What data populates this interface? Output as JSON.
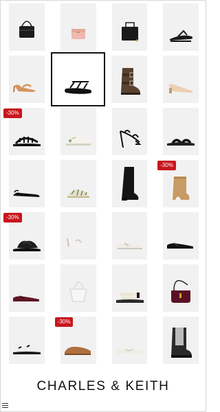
{
  "brand": {
    "name": "CHARLES & KEITH"
  },
  "menu": {
    "icon": "hamburger-menu-icon"
  },
  "accent": {
    "badge": "#c8161d",
    "tile_bg": "#f1f1f1"
  },
  "products": [
    {
      "icon": "black-tote-bag-icon"
    },
    {
      "icon": "pink-wallet-icon"
    },
    {
      "icon": "black-handbag-icon"
    },
    {
      "icon": "black-flip-flop-sandal-icon"
    },
    {
      "icon": "tan-slingback-heel-icon"
    },
    {
      "icon": "black-strappy-platform-sandal-icon"
    },
    {
      "icon": "brown-buckle-boot-icon"
    },
    {
      "icon": "beige-pointed-pump-icon"
    },
    {
      "icon": "black-woven-sandal-icon",
      "badge": "-30%"
    },
    {
      "icon": "white-sneaker-icon"
    },
    {
      "icon": "black-strappy-heel-icon"
    },
    {
      "icon": "black-slide-sandal-icon"
    },
    {
      "icon": "black-slingback-flat-icon"
    },
    {
      "icon": "mesh-fisherman-flat-icon"
    },
    {
      "icon": "black-knee-boot-icon"
    },
    {
      "icon": "tan-ankle-boot-icon",
      "badge": "-30%"
    },
    {
      "icon": "black-knot-mule-icon",
      "badge": "-30%"
    },
    {
      "icon": "white-slingback-heel-icon"
    },
    {
      "icon": "white-mary-jane-flat-icon"
    },
    {
      "icon": "black-mary-jane-flat-icon"
    },
    {
      "icon": "burgundy-mary-jane-flat-icon"
    },
    {
      "icon": "white-shoulder-bag-icon"
    },
    {
      "icon": "cream-sport-sandal-icon"
    },
    {
      "icon": "burgundy-shoulder-bag-icon"
    },
    {
      "icon": "black-white-flat-sandal-icon"
    },
    {
      "icon": "brown-suede-loafer-icon",
      "badge": "-30%"
    },
    {
      "icon": "white-ballet-flat-icon"
    },
    {
      "icon": "grey-chelsea-boot-icon"
    }
  ]
}
